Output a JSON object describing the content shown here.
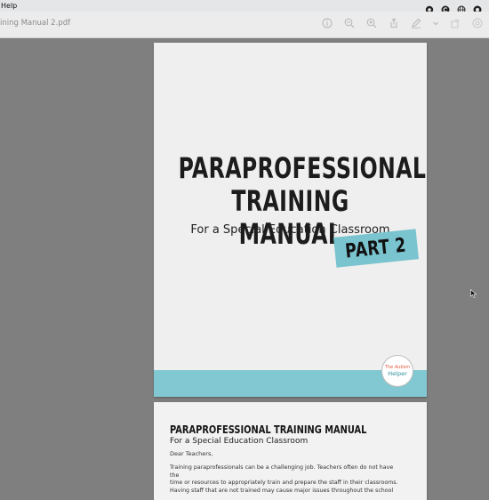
{
  "menubar": {
    "help_label": "Help"
  },
  "window": {
    "document_title": "ining Manual 2.pdf"
  },
  "toolbar": {
    "tools": [
      "info-icon",
      "zoom-out-icon",
      "zoom-in-icon",
      "share-icon",
      "markup-pen-icon",
      "chevron-down-icon",
      "rotate-icon",
      "search-icon"
    ]
  },
  "page1": {
    "headline_line1": "PARAPROFESSIONAL",
    "headline_line2": "TRAINING MANUAL",
    "subtitle": "For a Special Education Classroom",
    "badge": "PART 2",
    "logo_line1": "The Autism",
    "logo_line2": "Helper",
    "band_color": "#82c8d2"
  },
  "page2": {
    "title": "PARAPROFESSIONAL TRAINING MANUAL",
    "subtitle": "For a Special Education Classroom",
    "greeting": "Dear Teachers,",
    "body_line1": "Training paraprofessionals can be a challenging job. Teachers often do not have the",
    "body_line2": "time or resources to appropriately train and prepare the staff in their classrooms.",
    "body_line3": "Having staff that are not trained may cause major issues throughout the school"
  }
}
